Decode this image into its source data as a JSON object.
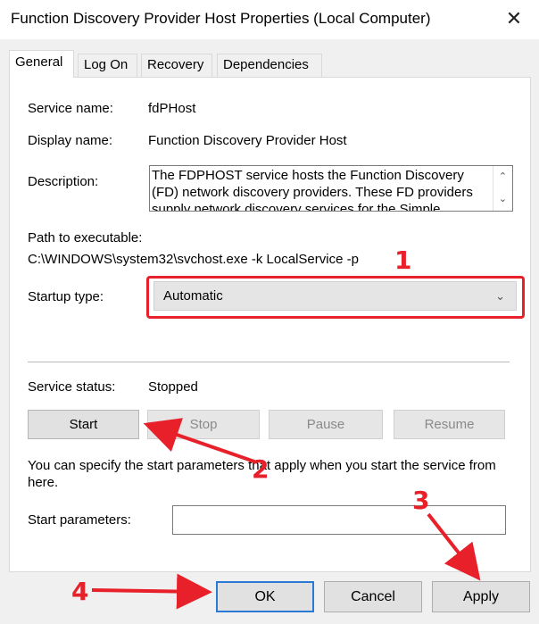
{
  "window": {
    "title": "Function Discovery Provider Host Properties (Local Computer)",
    "close_glyph": "✕"
  },
  "tabs": [
    {
      "label": "General",
      "active": true
    },
    {
      "label": "Log On",
      "active": false
    },
    {
      "label": "Recovery",
      "active": false
    },
    {
      "label": "Dependencies",
      "active": false
    }
  ],
  "general": {
    "service_name_label": "Service name:",
    "service_name_value": "fdPHost",
    "display_name_label": "Display name:",
    "display_name_value": "Function Discovery Provider Host",
    "description_label": "Description:",
    "description_value": "The FDPHOST service hosts the Function Discovery (FD) network discovery providers. These FD providers supply network discovery services for the Simple",
    "path_label": "Path to executable:",
    "path_value": "C:\\WINDOWS\\system32\\svchost.exe -k LocalService -p",
    "startup_type_label": "Startup type:",
    "startup_type_value": "Automatic",
    "service_status_label": "Service status:",
    "service_status_value": "Stopped",
    "buttons": {
      "start": "Start",
      "stop": "Stop",
      "pause": "Pause",
      "resume": "Resume"
    },
    "hint_text": "You can specify the start parameters that apply when you start the service from here.",
    "start_params_label": "Start parameters:",
    "start_params_value": ""
  },
  "footer": {
    "ok": "OK",
    "cancel": "Cancel",
    "apply": "Apply"
  },
  "annotations": {
    "marker_1": "1",
    "marker_2": "2",
    "marker_3": "3",
    "marker_4": "4",
    "color": "#e8202a"
  },
  "icons": {
    "scroll_up": "⌃",
    "scroll_down": "⌄",
    "dropdown": "⌄"
  }
}
